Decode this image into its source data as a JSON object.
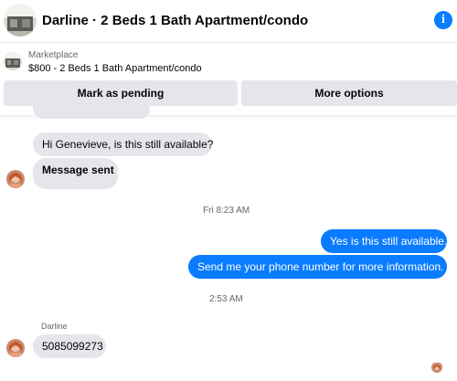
{
  "header": {
    "title": "Darline · 2 Beds 1 Bath Apartment/condo",
    "info_icon": "i"
  },
  "listing": {
    "source": "Marketplace",
    "price_title": "$800 - 2 Beds 1 Bath Apartment/condo"
  },
  "actions": {
    "mark_pending_label": "Mark as pending",
    "more_options_label": "More options"
  },
  "messages": [
    {
      "text": "Hi Genevieve, is this still available?",
      "direction": "incoming"
    },
    {
      "text": "Message sent",
      "direction": "incoming"
    },
    {
      "text": "Yes is this still available.",
      "direction": "outgoing"
    },
    {
      "text": "Send me your phone number for more information.",
      "direction": "outgoing"
    },
    {
      "text": "5085099273",
      "direction": "incoming"
    }
  ],
  "timestamps": {
    "first": "Fri 8:23 AM",
    "second": "2:53 AM"
  },
  "sender_name": "Darline",
  "colors": {
    "accent": "#0a7cff",
    "incoming_bubble": "#e4e6eb",
    "button_bg": "#e4e6eb",
    "secondary_text": "#65676b"
  }
}
